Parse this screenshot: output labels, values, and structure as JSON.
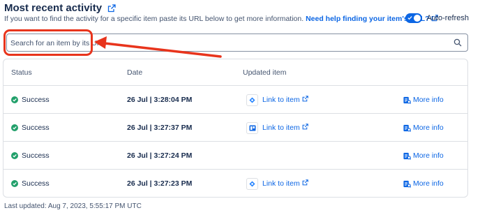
{
  "header": {
    "title": "Most recent activity",
    "subtitle": "If you want to find the activity for a specific item paste its URL below to get more information.",
    "help_link": "Need help finding your item's URL?"
  },
  "auto_refresh": {
    "label": "Auto-refresh",
    "enabled": true
  },
  "search": {
    "placeholder": "Search for an item by its URL",
    "value": ""
  },
  "table": {
    "columns": [
      "Status",
      "Date",
      "Updated item"
    ],
    "rows": [
      {
        "status": "Success",
        "date": "26 Jul | 3:28:04 PM",
        "item_link": "Link to item",
        "item_icon": "jira-diamond-icon",
        "more_info": "More info"
      },
      {
        "status": "Success",
        "date": "26 Jul | 3:27:37 PM",
        "item_link": "Link to item",
        "item_icon": "board-icon",
        "more_info": "More info"
      },
      {
        "status": "Success",
        "date": "26 Jul | 3:27:24 PM",
        "item_link": "",
        "item_icon": "",
        "more_info": "More info"
      },
      {
        "status": "Success",
        "date": "26 Jul | 3:27:23 PM",
        "item_link": "Link to item",
        "item_icon": "jira-diamond-icon",
        "more_info": "More info"
      }
    ]
  },
  "footer": {
    "last_updated": "Last updated: Aug 7, 2023, 5:55:17 PM UTC"
  },
  "colors": {
    "accent": "#0c66e4",
    "success": "#22a06b",
    "annotation": "#e8341c"
  }
}
